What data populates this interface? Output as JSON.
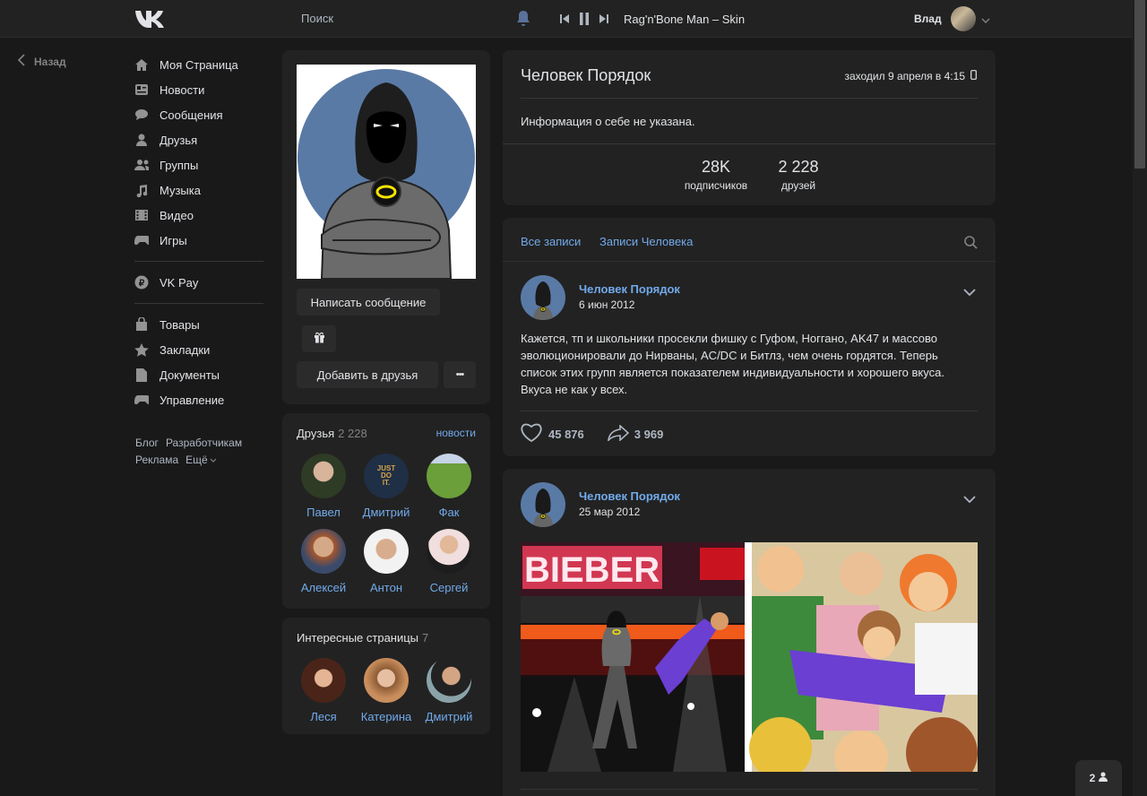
{
  "header": {
    "search_label": "Поиск",
    "player": {
      "track": "Rag'n'Bone Man – Skin"
    },
    "user_name": "Влад"
  },
  "back_label": "Назад",
  "sidebar": {
    "items": [
      {
        "label": "Моя Страница",
        "icon": "home-icon"
      },
      {
        "label": "Новости",
        "icon": "news-icon"
      },
      {
        "label": "Сообщения",
        "icon": "messages-icon"
      },
      {
        "label": "Друзья",
        "icon": "friends-icon"
      },
      {
        "label": "Группы",
        "icon": "groups-icon"
      },
      {
        "label": "Музыка",
        "icon": "music-icon"
      },
      {
        "label": "Видео",
        "icon": "video-icon"
      },
      {
        "label": "Игры",
        "icon": "games-icon"
      }
    ],
    "pay": {
      "label": "VK Pay",
      "icon": "vkpay-icon"
    },
    "extra": [
      {
        "label": "Товары",
        "icon": "bag-icon"
      },
      {
        "label": "Закладки",
        "icon": "star-icon"
      },
      {
        "label": "Документы",
        "icon": "document-icon"
      },
      {
        "label": "Управление",
        "icon": "gamepad-icon"
      }
    ],
    "footer": {
      "blog": "Блог",
      "dev": "Разработчикам",
      "ads": "Реклама",
      "more": "Ещё"
    }
  },
  "profile": {
    "name": "Человек Порядок",
    "last_seen": "заходил 9 апреля в 4:15",
    "about": "Информация о себе не указана.",
    "stats": [
      {
        "value": "28K",
        "label": "подписчиков"
      },
      {
        "value": "2 228",
        "label": "друзей"
      }
    ],
    "buttons": {
      "message": "Написать сообщение",
      "add_friend": "Добавить в друзья",
      "more": "•••"
    }
  },
  "friends": {
    "title": "Друзья",
    "count": "2 228",
    "link": "новости",
    "list": [
      {
        "name": "Павел"
      },
      {
        "name": "Дмитрий"
      },
      {
        "name": "Фак"
      },
      {
        "name": "Алексей"
      },
      {
        "name": "Антон"
      },
      {
        "name": "Сергей"
      }
    ]
  },
  "interesting": {
    "title": "Интересные страницы",
    "count": "7",
    "list": [
      {
        "name": "Леся"
      },
      {
        "name": "Катерина"
      },
      {
        "name": "Дмитрий"
      }
    ]
  },
  "wall": {
    "tabs": [
      "Все записи",
      "Записи Человека"
    ],
    "posts": [
      {
        "author": "Человек Порядок",
        "date": "6 июн 2012",
        "text": "Кажется, тп и школьники просекли фишку с Гуфом, Ноггано, AK47 и массово эволюционировали до Нирваны, AC/DC и Битлз, чем очень гордятся. Теперь список этих групп является показателем индивидуальности и хорошего вкуса. Вкуса не как у всех.",
        "likes": "45 876",
        "shares": "3 969"
      },
      {
        "author": "Человек Порядок",
        "date": "25 мар 2012",
        "image_sign": "BIEBER"
      }
    ]
  },
  "online_badge": "2",
  "colors": {
    "bg": "#19191a",
    "card": "#222222",
    "link": "#71aaeb",
    "text": "#e1e3e6"
  }
}
